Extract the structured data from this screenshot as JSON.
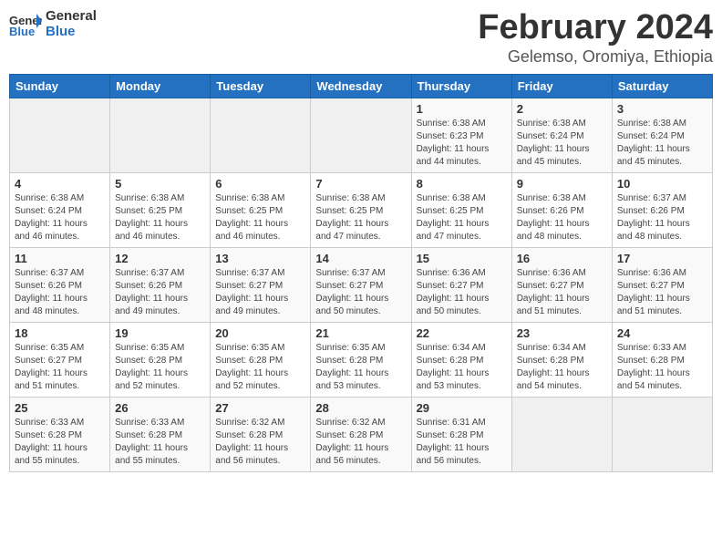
{
  "logo": {
    "general": "General",
    "blue": "Blue"
  },
  "title": {
    "month": "February 2024",
    "location": "Gelemso, Oromiya, Ethiopia"
  },
  "weekdays": [
    "Sunday",
    "Monday",
    "Tuesday",
    "Wednesday",
    "Thursday",
    "Friday",
    "Saturday"
  ],
  "weeks": [
    [
      {
        "day": "",
        "sunrise": "",
        "sunset": "",
        "daylight": ""
      },
      {
        "day": "",
        "sunrise": "",
        "sunset": "",
        "daylight": ""
      },
      {
        "day": "",
        "sunrise": "",
        "sunset": "",
        "daylight": ""
      },
      {
        "day": "",
        "sunrise": "",
        "sunset": "",
        "daylight": ""
      },
      {
        "day": "1",
        "sunrise": "Sunrise: 6:38 AM",
        "sunset": "Sunset: 6:23 PM",
        "daylight": "Daylight: 11 hours and 44 minutes."
      },
      {
        "day": "2",
        "sunrise": "Sunrise: 6:38 AM",
        "sunset": "Sunset: 6:24 PM",
        "daylight": "Daylight: 11 hours and 45 minutes."
      },
      {
        "day": "3",
        "sunrise": "Sunrise: 6:38 AM",
        "sunset": "Sunset: 6:24 PM",
        "daylight": "Daylight: 11 hours and 45 minutes."
      }
    ],
    [
      {
        "day": "4",
        "sunrise": "Sunrise: 6:38 AM",
        "sunset": "Sunset: 6:24 PM",
        "daylight": "Daylight: 11 hours and 46 minutes."
      },
      {
        "day": "5",
        "sunrise": "Sunrise: 6:38 AM",
        "sunset": "Sunset: 6:25 PM",
        "daylight": "Daylight: 11 hours and 46 minutes."
      },
      {
        "day": "6",
        "sunrise": "Sunrise: 6:38 AM",
        "sunset": "Sunset: 6:25 PM",
        "daylight": "Daylight: 11 hours and 46 minutes."
      },
      {
        "day": "7",
        "sunrise": "Sunrise: 6:38 AM",
        "sunset": "Sunset: 6:25 PM",
        "daylight": "Daylight: 11 hours and 47 minutes."
      },
      {
        "day": "8",
        "sunrise": "Sunrise: 6:38 AM",
        "sunset": "Sunset: 6:25 PM",
        "daylight": "Daylight: 11 hours and 47 minutes."
      },
      {
        "day": "9",
        "sunrise": "Sunrise: 6:38 AM",
        "sunset": "Sunset: 6:26 PM",
        "daylight": "Daylight: 11 hours and 48 minutes."
      },
      {
        "day": "10",
        "sunrise": "Sunrise: 6:37 AM",
        "sunset": "Sunset: 6:26 PM",
        "daylight": "Daylight: 11 hours and 48 minutes."
      }
    ],
    [
      {
        "day": "11",
        "sunrise": "Sunrise: 6:37 AM",
        "sunset": "Sunset: 6:26 PM",
        "daylight": "Daylight: 11 hours and 48 minutes."
      },
      {
        "day": "12",
        "sunrise": "Sunrise: 6:37 AM",
        "sunset": "Sunset: 6:26 PM",
        "daylight": "Daylight: 11 hours and 49 minutes."
      },
      {
        "day": "13",
        "sunrise": "Sunrise: 6:37 AM",
        "sunset": "Sunset: 6:27 PM",
        "daylight": "Daylight: 11 hours and 49 minutes."
      },
      {
        "day": "14",
        "sunrise": "Sunrise: 6:37 AM",
        "sunset": "Sunset: 6:27 PM",
        "daylight": "Daylight: 11 hours and 50 minutes."
      },
      {
        "day": "15",
        "sunrise": "Sunrise: 6:36 AM",
        "sunset": "Sunset: 6:27 PM",
        "daylight": "Daylight: 11 hours and 50 minutes."
      },
      {
        "day": "16",
        "sunrise": "Sunrise: 6:36 AM",
        "sunset": "Sunset: 6:27 PM",
        "daylight": "Daylight: 11 hours and 51 minutes."
      },
      {
        "day": "17",
        "sunrise": "Sunrise: 6:36 AM",
        "sunset": "Sunset: 6:27 PM",
        "daylight": "Daylight: 11 hours and 51 minutes."
      }
    ],
    [
      {
        "day": "18",
        "sunrise": "Sunrise: 6:35 AM",
        "sunset": "Sunset: 6:27 PM",
        "daylight": "Daylight: 11 hours and 51 minutes."
      },
      {
        "day": "19",
        "sunrise": "Sunrise: 6:35 AM",
        "sunset": "Sunset: 6:28 PM",
        "daylight": "Daylight: 11 hours and 52 minutes."
      },
      {
        "day": "20",
        "sunrise": "Sunrise: 6:35 AM",
        "sunset": "Sunset: 6:28 PM",
        "daylight": "Daylight: 11 hours and 52 minutes."
      },
      {
        "day": "21",
        "sunrise": "Sunrise: 6:35 AM",
        "sunset": "Sunset: 6:28 PM",
        "daylight": "Daylight: 11 hours and 53 minutes."
      },
      {
        "day": "22",
        "sunrise": "Sunrise: 6:34 AM",
        "sunset": "Sunset: 6:28 PM",
        "daylight": "Daylight: 11 hours and 53 minutes."
      },
      {
        "day": "23",
        "sunrise": "Sunrise: 6:34 AM",
        "sunset": "Sunset: 6:28 PM",
        "daylight": "Daylight: 11 hours and 54 minutes."
      },
      {
        "day": "24",
        "sunrise": "Sunrise: 6:33 AM",
        "sunset": "Sunset: 6:28 PM",
        "daylight": "Daylight: 11 hours and 54 minutes."
      }
    ],
    [
      {
        "day": "25",
        "sunrise": "Sunrise: 6:33 AM",
        "sunset": "Sunset: 6:28 PM",
        "daylight": "Daylight: 11 hours and 55 minutes."
      },
      {
        "day": "26",
        "sunrise": "Sunrise: 6:33 AM",
        "sunset": "Sunset: 6:28 PM",
        "daylight": "Daylight: 11 hours and 55 minutes."
      },
      {
        "day": "27",
        "sunrise": "Sunrise: 6:32 AM",
        "sunset": "Sunset: 6:28 PM",
        "daylight": "Daylight: 11 hours and 56 minutes."
      },
      {
        "day": "28",
        "sunrise": "Sunrise: 6:32 AM",
        "sunset": "Sunset: 6:28 PM",
        "daylight": "Daylight: 11 hours and 56 minutes."
      },
      {
        "day": "29",
        "sunrise": "Sunrise: 6:31 AM",
        "sunset": "Sunset: 6:28 PM",
        "daylight": "Daylight: 11 hours and 56 minutes."
      },
      {
        "day": "",
        "sunrise": "",
        "sunset": "",
        "daylight": ""
      },
      {
        "day": "",
        "sunrise": "",
        "sunset": "",
        "daylight": ""
      }
    ]
  ]
}
